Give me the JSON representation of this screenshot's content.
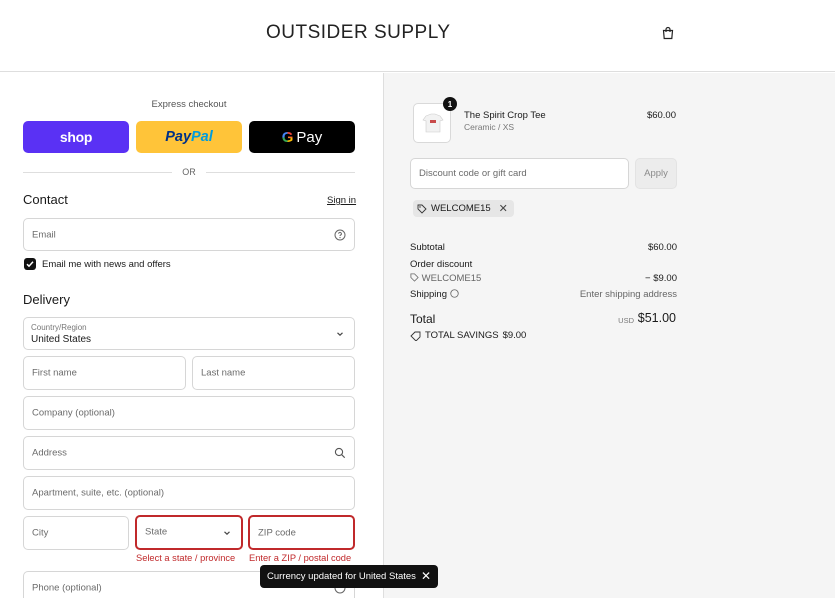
{
  "header": {
    "brand": "OUTSIDER SUPPLY"
  },
  "express": {
    "title": "Express checkout",
    "shop_label": "shop",
    "paypal_a": "Pay",
    "paypal_b": "Pal",
    "gpay_g": "G",
    "gpay_label": "Pay",
    "or_text": "OR"
  },
  "contact": {
    "title": "Contact",
    "sign_in": "Sign in",
    "email_placeholder": "Email",
    "newsletter_label": "Email me with news and offers"
  },
  "delivery": {
    "title": "Delivery",
    "country_label": "Country/Region",
    "country_value": "United States",
    "first_name": "First name",
    "last_name": "Last name",
    "company": "Company (optional)",
    "address": "Address",
    "apartment": "Apartment, suite, etc. (optional)",
    "city": "City",
    "state": "State",
    "zip": "ZIP code",
    "state_error": "Select a state / province",
    "zip_error": "Enter a ZIP / postal code",
    "phone": "Phone (optional)"
  },
  "toast": {
    "text": "Currency updated for United States"
  },
  "summary": {
    "item": {
      "qty": "1",
      "name": "The Spirit Crop Tee",
      "variant": "Ceramic / XS",
      "price": "$60.00"
    },
    "discount_placeholder": "Discount code or gift card",
    "apply_label": "Apply",
    "chip_code": "WELCOME15",
    "subtotal_label": "Subtotal",
    "subtotal_value": "$60.00",
    "order_discount_label": "Order discount",
    "discount_code": "WELCOME15",
    "discount_value": "− $9.00",
    "shipping_label": "Shipping",
    "shipping_value": "Enter shipping address",
    "total_label": "Total",
    "currency": "USD",
    "total_value": "$51.00",
    "savings_label": "TOTAL SAVINGS",
    "savings_value": "$9.00"
  }
}
